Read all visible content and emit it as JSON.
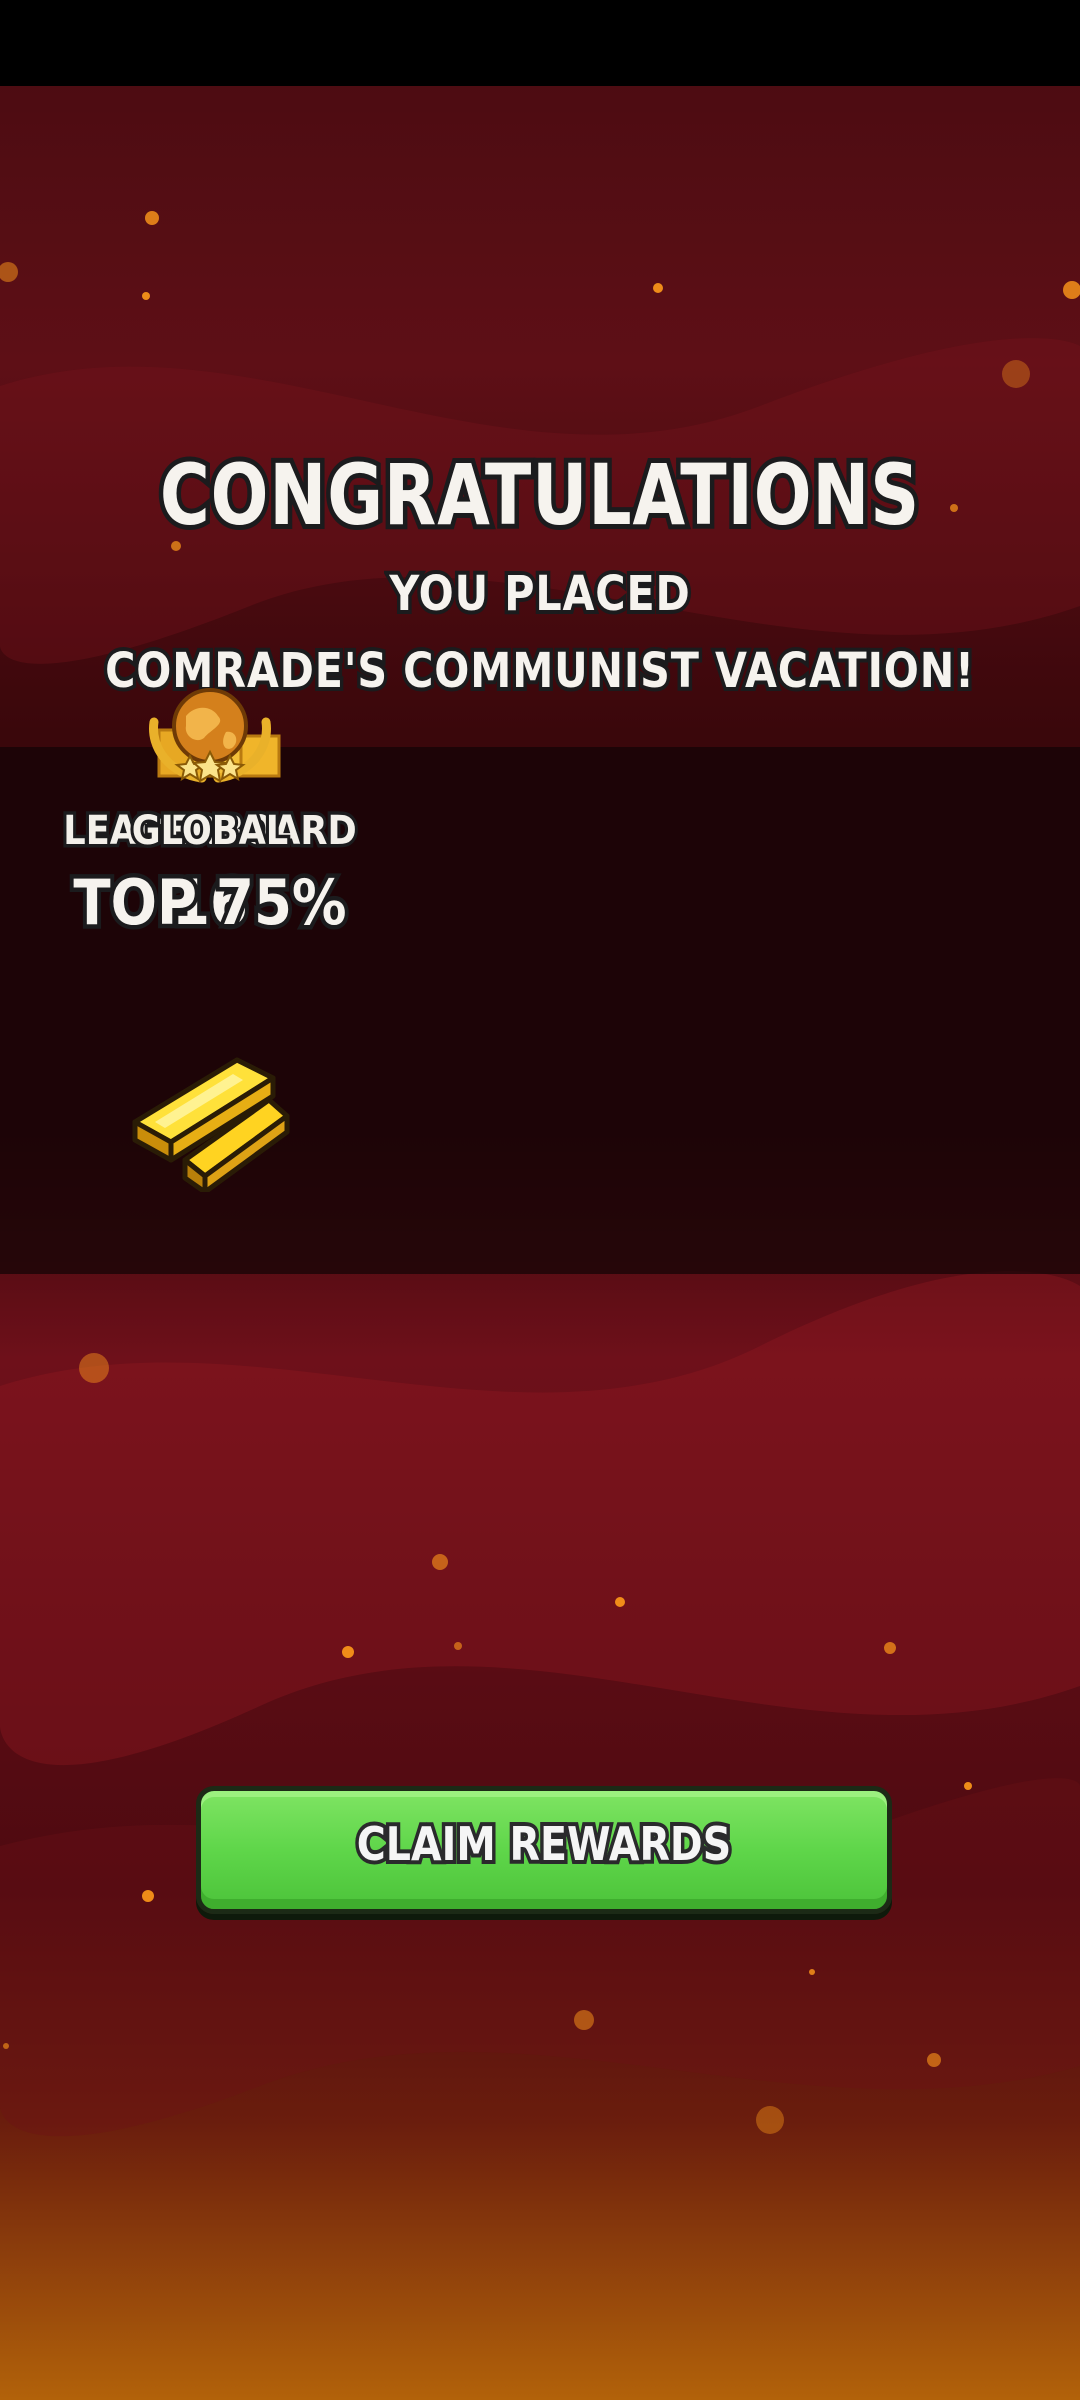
{
  "screen": {
    "title": "CONGRATULATIONS",
    "subtitle": "YOU PLACED",
    "event_name": "COMRADE'S COMMUNIST VACATION!"
  },
  "results": {
    "leaderboard": {
      "label": "LEADERBOARD",
      "value": "16",
      "icon": "podium-icon",
      "reward_icon": "gold-bars-icon"
    },
    "global": {
      "label": "GLOBAL",
      "value": "TOP 75%",
      "icon": "globe-laurel-medal-icon",
      "reward_icon": "gold-bars-icon"
    }
  },
  "actions": {
    "claim_label": "CLAIM REWARDS"
  },
  "colors": {
    "background_top": "#4d0c12",
    "background_bottom": "#b2620a",
    "button_green": "#5fd64a",
    "gold": "#f5c518"
  }
}
